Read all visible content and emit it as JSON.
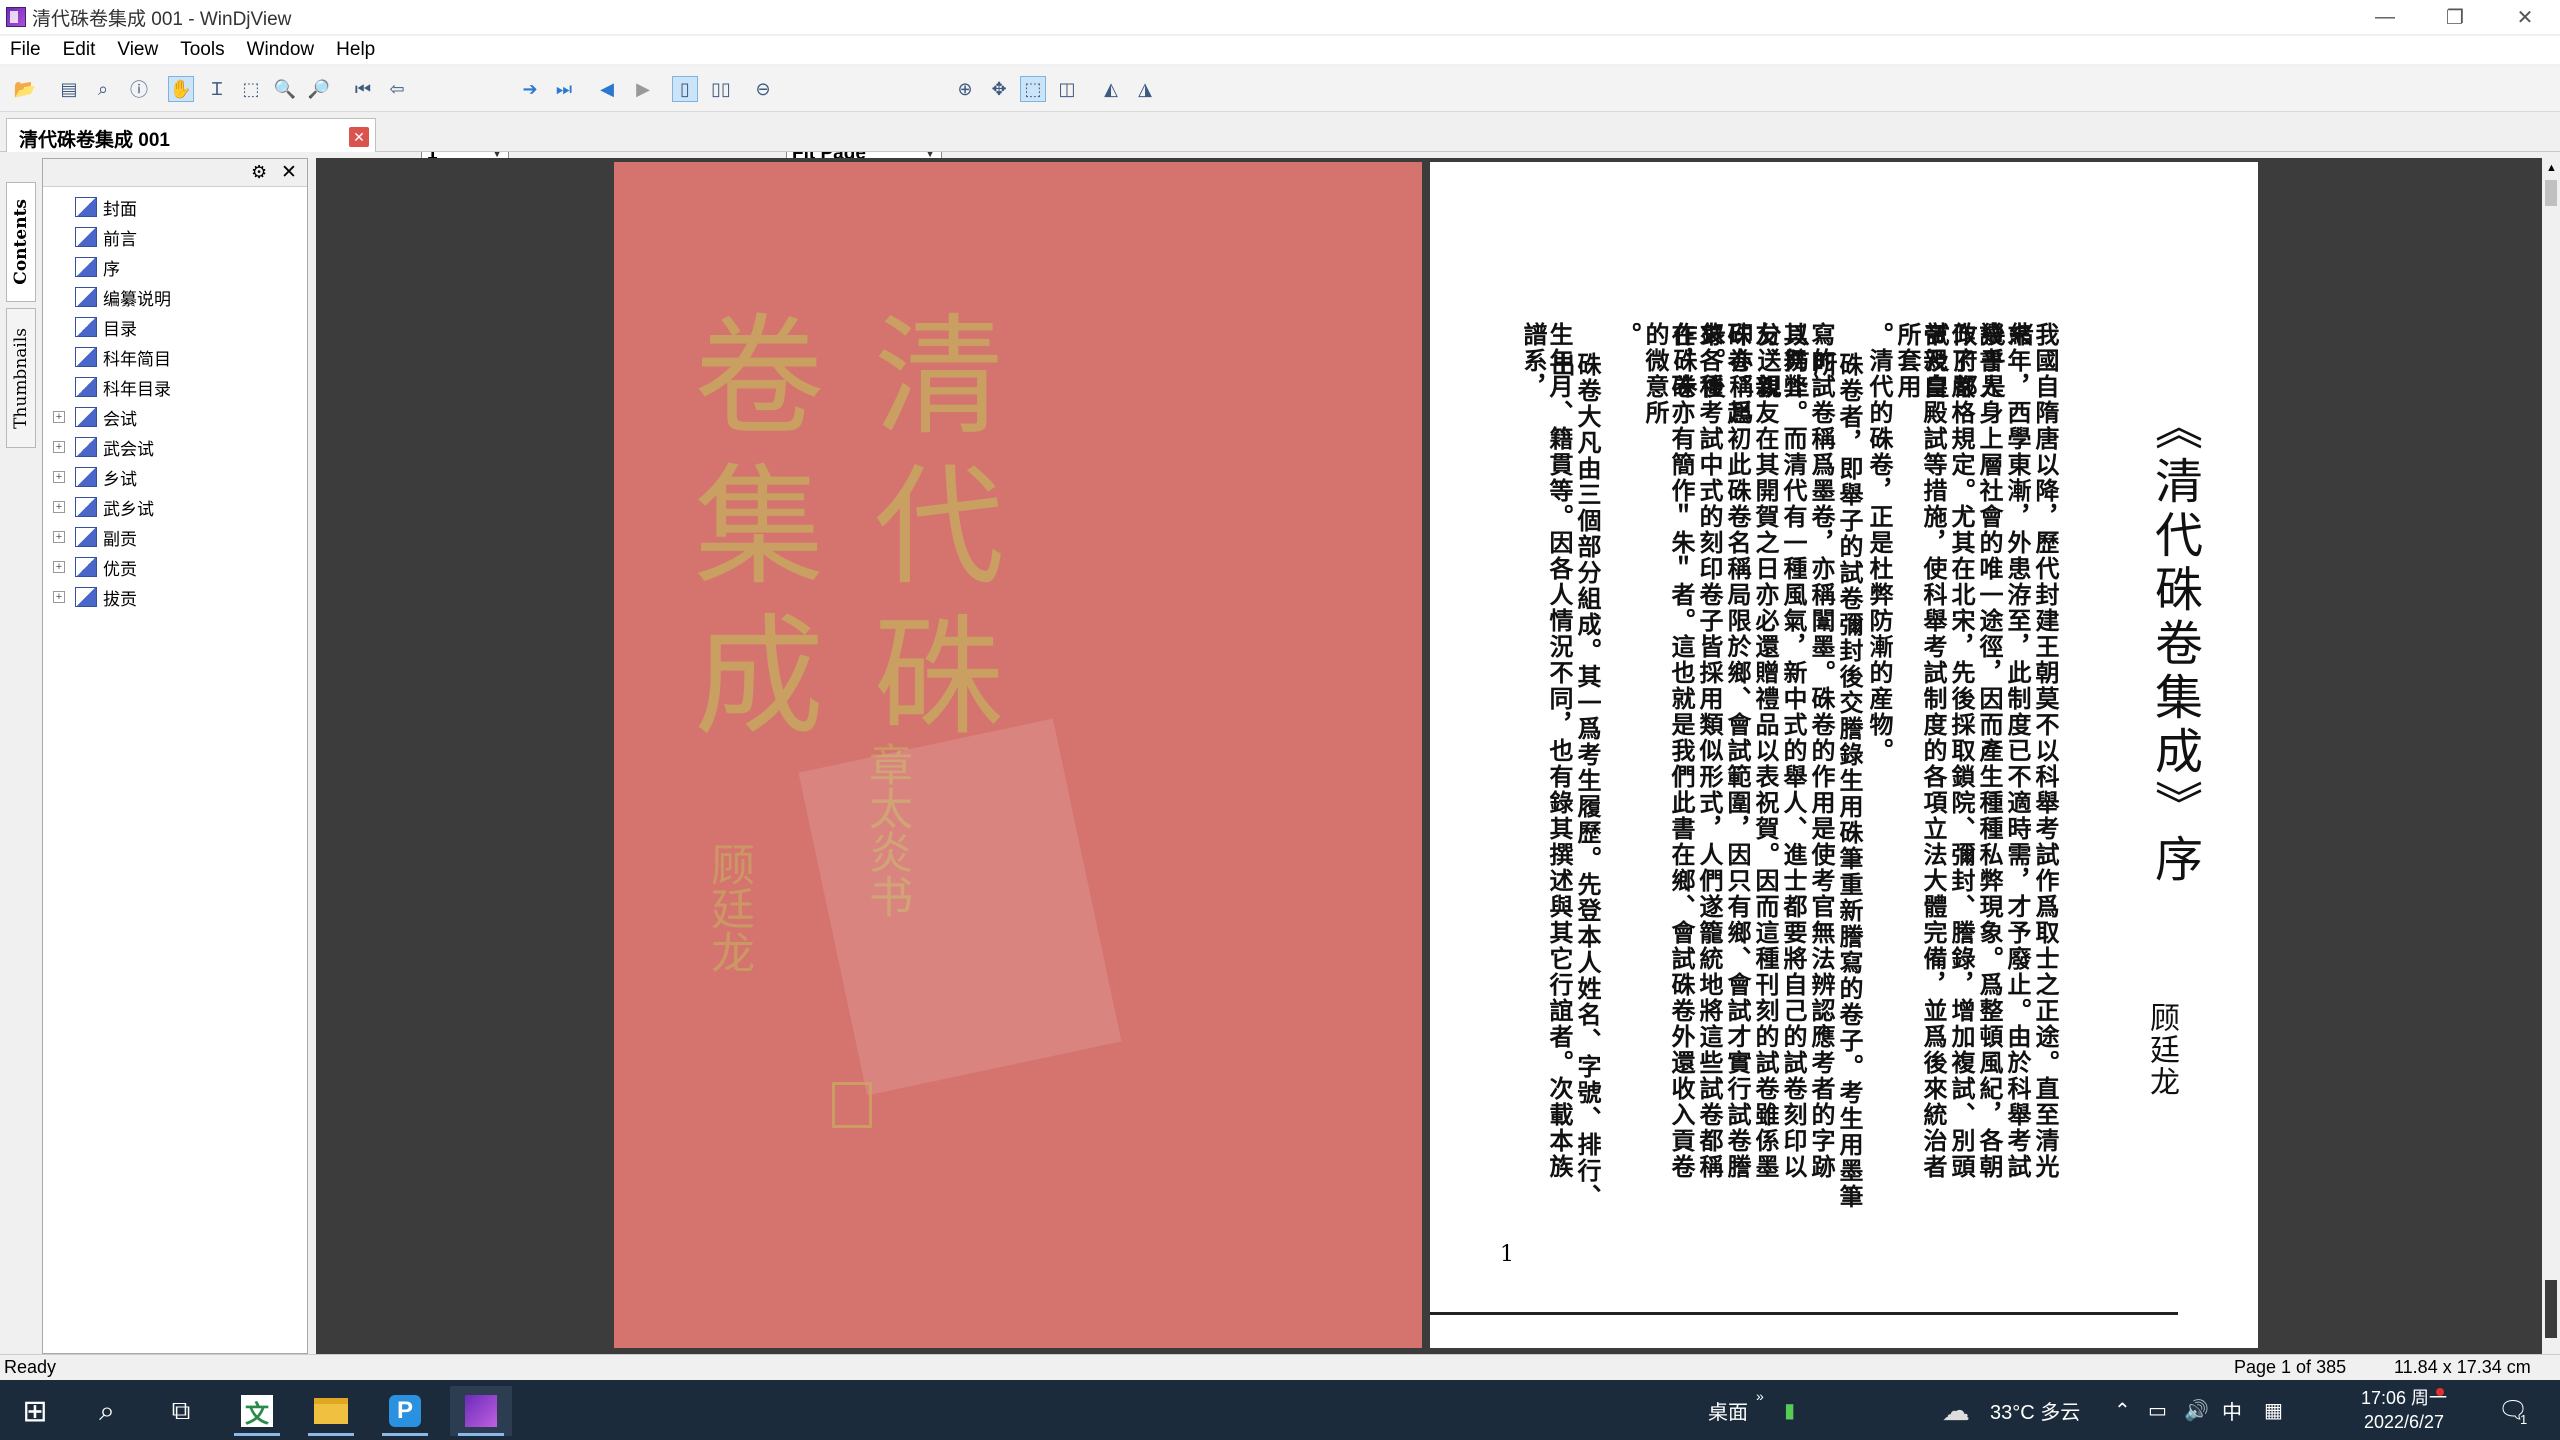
{
  "window": {
    "title": "清代硃卷集成  001 - WinDjView",
    "controls": {
      "minimize": "—",
      "maximize": "❐",
      "close": "✕"
    }
  },
  "menu": [
    "File",
    "Edit",
    "View",
    "Tools",
    "Window",
    "Help"
  ],
  "toolbar": {
    "page_value": "1",
    "zoom_value": "Fit Page"
  },
  "tab": {
    "label": "清代硃卷集成   001"
  },
  "vtabs": {
    "contents": "Contents",
    "thumbnails": "Thumbnails"
  },
  "tree": [
    {
      "label": "封面",
      "expandable": false
    },
    {
      "label": "前言",
      "expandable": false
    },
    {
      "label": "序",
      "expandable": false
    },
    {
      "label": "编纂说明",
      "expandable": false
    },
    {
      "label": "目录",
      "expandable": false
    },
    {
      "label": "科年简目",
      "expandable": false
    },
    {
      "label": "科年目录",
      "expandable": false
    },
    {
      "label": "会试",
      "expandable": true
    },
    {
      "label": "武会试",
      "expandable": true
    },
    {
      "label": "乡试",
      "expandable": true
    },
    {
      "label": "武乡试",
      "expandable": true
    },
    {
      "label": "副贡",
      "expandable": true
    },
    {
      "label": "优贡",
      "expandable": true
    },
    {
      "label": "拔贡",
      "expandable": true
    }
  ],
  "cover": {
    "title_col1": "清代硃",
    "title_col2": "卷集成",
    "calligrapher": "顾廷龙",
    "inscription": "章太炎书"
  },
  "preface": {
    "heading": "《清代硃卷集成》序",
    "author": "顾廷龙",
    "page_number": "1",
    "columns": [
      "我國自隋唐以降，歷代封建王朝莫不以科舉考試作爲取士之正途。直至清光緒",
      "末年，西學東漸，外患洊至，此制度已不適時需，才予廢止。由於科舉考試幾乎是",
      "讀書人身上層社會的唯一途徑，因而產生種種私弊現象。爲整頓風紀，各朝政府都",
      "作了嚴格規定。尤其在北宋，先後採取鎖院、彌封、謄錄，增加複試、別頭試及皇",
      "帝親自殿試等措施，使科舉考試制度的各項立法大體完備，並爲後來統治者所套用",
      "。清代的硃卷，正是杜弊防漸的産物。",
      "硃卷者，即舉子的試卷彌封後交謄錄生用硃筆重新謄寫的卷子。考生用墨筆所",
      "寫的試卷稱爲墨卷，亦稱闈墨。硃卷的作用是使考官無法辨認應考者的字跡以防止",
      "其舞弊。而清代有一種風氣，新中式的舉人、進士都要將自己的試卷刻印以分送親",
      "友、親友在其開賀之日亦必還贈禮品以表祝賀。因而這種刊刻的試卷雖係墨印亦稱爲",
      "硃卷。起初此硃卷名稱局限於鄉、會試範圍，因只有鄉、會試才實行試卷謄錄。後",
      "來各種考試中式的刻印卷子皆採用類似形式，人們遂籠統地將這些試卷都稱作硃卷",
      "在，硃亦有簡作＂朱＂者。這也就是我們此書在鄉、會試硃卷外還收入貢卷的微意所",
      "。",
      "硃卷大凡由三個部分組成。其一爲考生履歷。先登本人姓名、字號、排行、出",
      "生年月、籍貫等。因各人情況不同，也有錄其撰述與其它行誼者。次載本族譜系，"
    ]
  },
  "status": {
    "left": "Ready",
    "page": "Page 1 of 385",
    "size": "11.84 x 17.34 cm"
  },
  "taskbar": {
    "desktop_label": "桌面",
    "weather": "33°C  多云",
    "ime": "中",
    "time": "17:06 周一",
    "date": "2022/6/27",
    "notification_count": "1"
  }
}
